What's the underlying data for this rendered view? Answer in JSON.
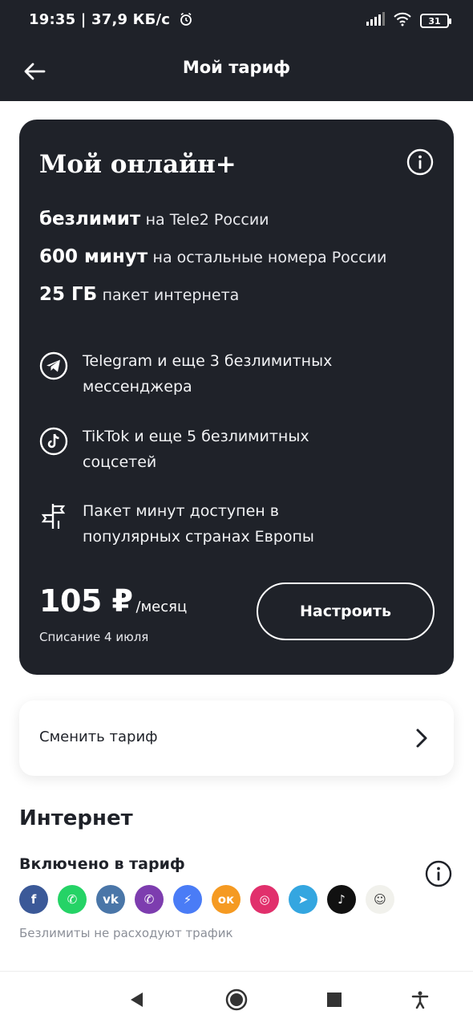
{
  "status_bar": {
    "time_text": "19:35 | 37,9 КБ/с",
    "battery": "31",
    "icons": [
      "alarm-icon",
      "signal-icon",
      "wifi-icon",
      "battery-icon"
    ]
  },
  "header": {
    "title": "Мой тариф",
    "back_icon": "arrow-left-icon"
  },
  "tariff": {
    "name": "Мой онлайн+",
    "features": [
      {
        "bold": "безлимит",
        "text": "на Tele2 России"
      },
      {
        "bold": "600 минут",
        "text": "на остальные номера России"
      },
      {
        "bold": "25 ГБ",
        "text": "пакет интернета"
      }
    ],
    "perks": [
      {
        "icon": "telegram-icon",
        "line1": "Telegram и еще 3 безлимитных",
        "line2": "мессенджера"
      },
      {
        "icon": "tiktok-icon",
        "line1": "TikTok и еще 5 безлимитных",
        "line2": "соцсетей"
      },
      {
        "icon": "signpost-icon",
        "line1": "Пакет минут доступен в",
        "line2": "популярных странах Европы"
      }
    ],
    "price": "105 ₽",
    "price_unit": "/месяц",
    "billing": "Списание 4 июля",
    "configure_label": "Настроить"
  },
  "change_tariff": {
    "label": "Сменить тариф"
  },
  "internet": {
    "title": "Интернет",
    "included_title": "Включено в тариф",
    "apps": [
      {
        "name": "facebook",
        "color": "#3b5998",
        "glyph": "f"
      },
      {
        "name": "whatsapp",
        "color": "#25d366",
        "glyph": "✆"
      },
      {
        "name": "vk",
        "color": "#4a76a8",
        "glyph": "vk"
      },
      {
        "name": "viber",
        "color": "#7d3daf",
        "glyph": "✆"
      },
      {
        "name": "messenger",
        "color": "#4a7cf6",
        "glyph": "⚡"
      },
      {
        "name": "odnoklassniki",
        "color": "#f59a22",
        "glyph": "ок"
      },
      {
        "name": "instagram",
        "color": "#e1306c",
        "glyph": "◎"
      },
      {
        "name": "telegram",
        "color": "#34a6e0",
        "glyph": "➤"
      },
      {
        "name": "tiktok",
        "color": "#111111",
        "glyph": "♪"
      },
      {
        "name": "avatar-app",
        "color": "#f1f1ec",
        "glyph": "☺"
      }
    ],
    "note": "Безлимиты не расходуют трафик"
  },
  "nav": {
    "icons": [
      "back-triangle-icon",
      "home-circle-icon",
      "recents-square-icon",
      "accessibility-icon"
    ]
  }
}
